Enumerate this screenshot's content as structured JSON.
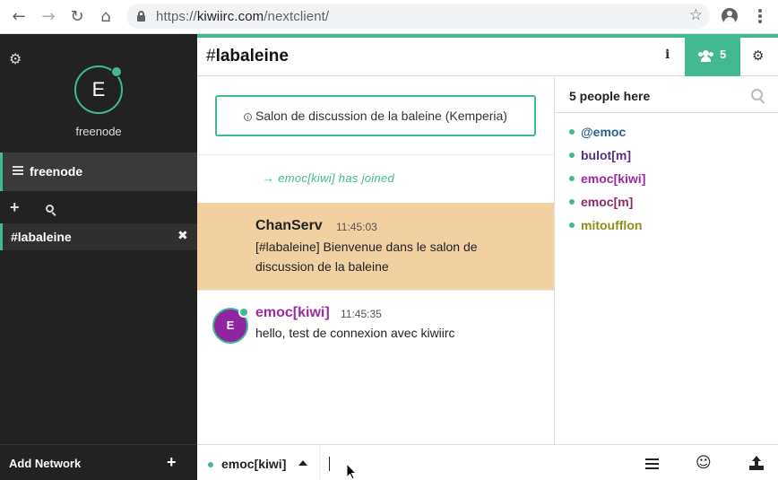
{
  "browser": {
    "url_scheme": "https://",
    "url_host": "kiwiirc.com",
    "url_path": "/nextclient/",
    "back_glyph": "←",
    "forward_glyph": "→",
    "reload_glyph": "↻",
    "home_glyph": "⌂",
    "star_glyph": "☆"
  },
  "sidebar": {
    "settings_glyph": "⚙",
    "avatar_letter": "E",
    "network_name": "freenode",
    "network_row_label": "freenode",
    "add_glyph": "+",
    "channel_label": "#labaleine",
    "close_glyph": "✖",
    "add_network_label": "Add Network",
    "add_network_glyph": "+"
  },
  "header": {
    "channel_hash": "#",
    "channel_name": "labaleine",
    "info_glyph": "i",
    "people_count": "5",
    "settings_glyph": "⚙"
  },
  "messages": {
    "topic_icon": "i",
    "topic": "Salon de discussion de la baleine (Kemperia)",
    "join_text": "→ emoc[kiwi] has joined",
    "items": [
      {
        "nick": "ChanServ",
        "time": "11:45:03",
        "text": "[#labaleine] Bienvenue dans le salon de discussion de la baleine"
      },
      {
        "avatar_letter": "E",
        "nick": "emoc[kiwi]",
        "time": "11:45:35",
        "text": "hello, test de connexion avec kiwiirc"
      }
    ]
  },
  "nicklist": {
    "header": "5 people here",
    "nicks": [
      {
        "name": "@emoc",
        "color": "#2a5f8f"
      },
      {
        "name": "bulot[m]",
        "color": "#5a2d82"
      },
      {
        "name": "emoc[kiwi]",
        "color": "#9c2aa0"
      },
      {
        "name": "emoc[m]",
        "color": "#8e2a6a"
      },
      {
        "name": "mitoufflon",
        "color": "#8e8e1a"
      }
    ]
  },
  "inputbar": {
    "self_nick": "emoc[kiwi]",
    "input_value": "",
    "emoji_glyph": "☺"
  },
  "colors": {
    "accent": "#42b992",
    "sidebar_bg": "#222222",
    "highlight_bg": "#f1d1a1"
  }
}
